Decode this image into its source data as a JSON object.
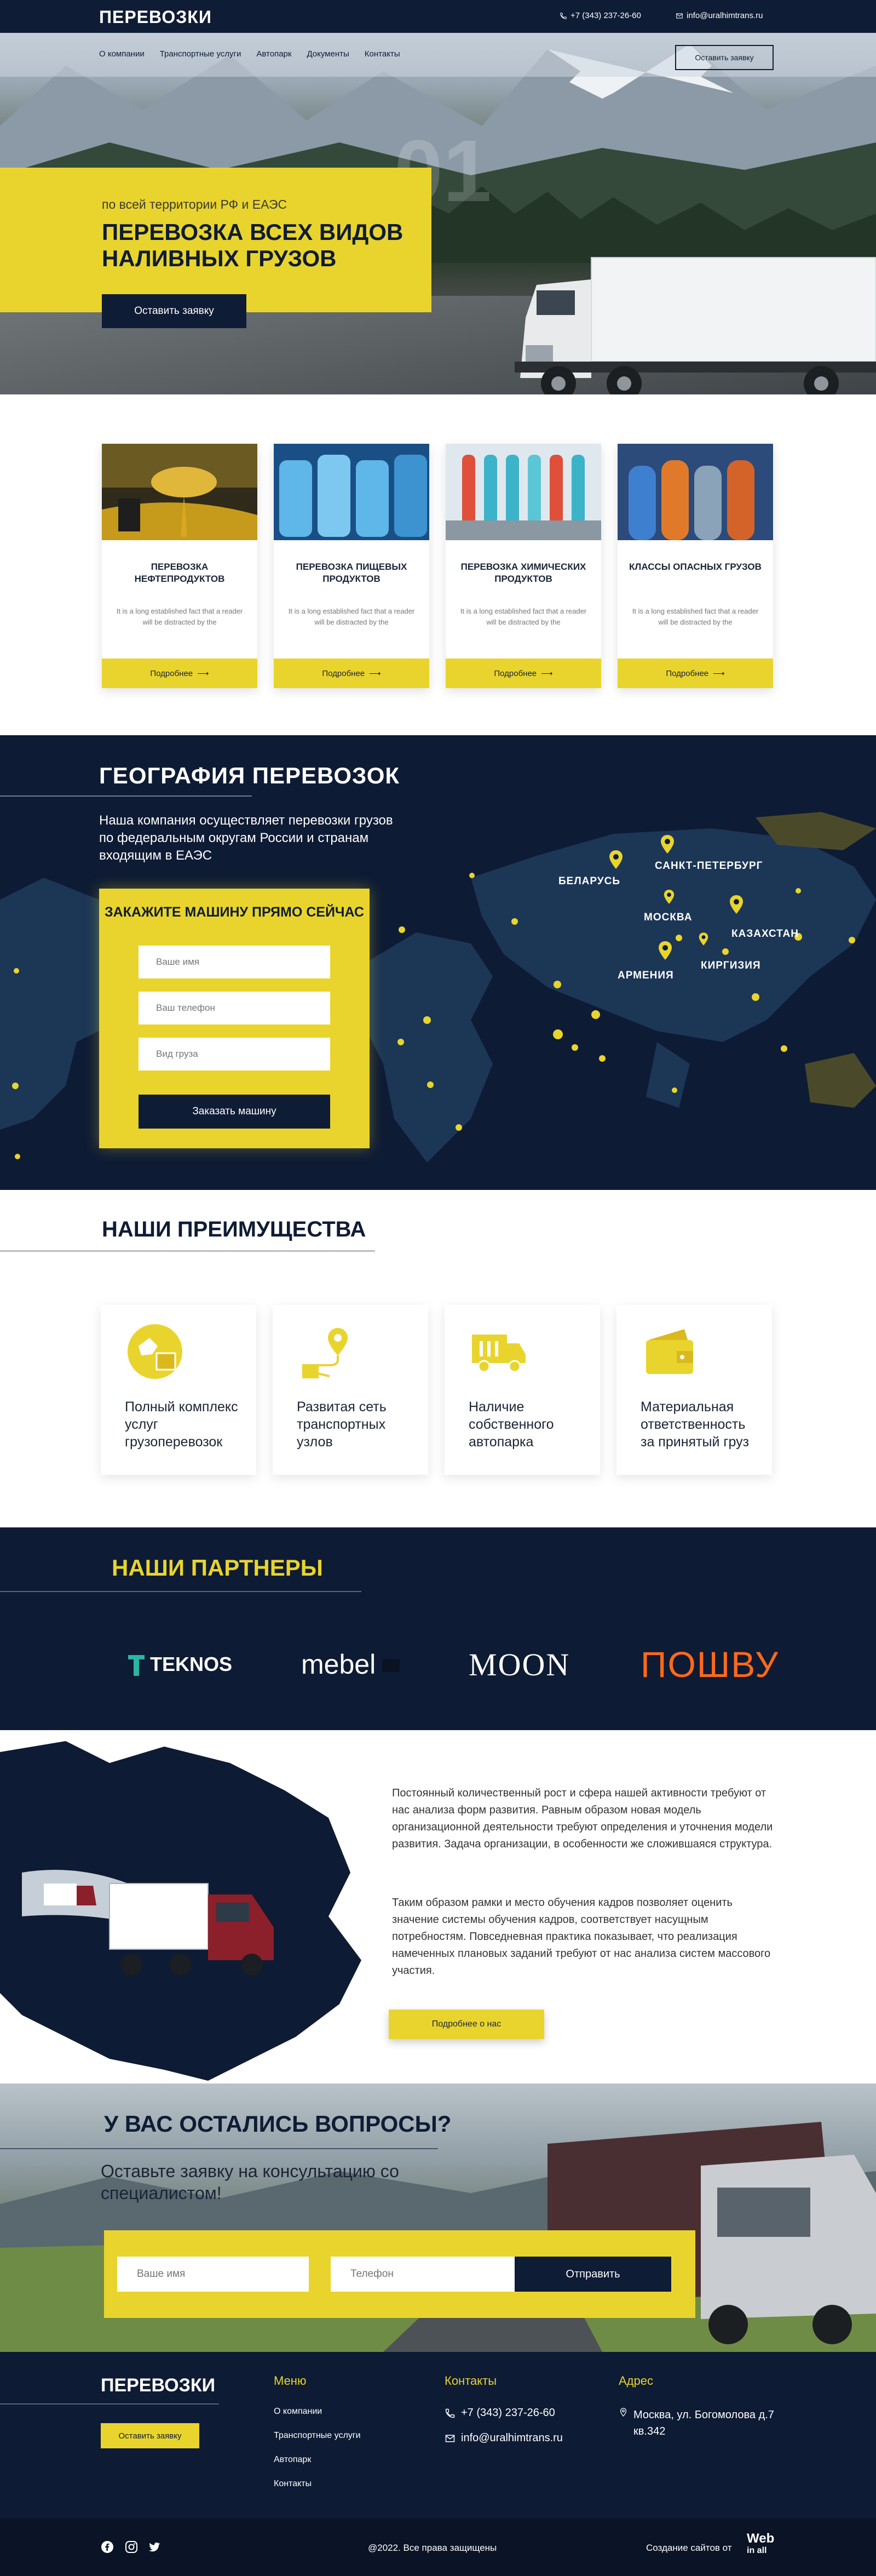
{
  "header": {
    "logo": "ПЕРЕВОЗКИ",
    "phone": "+7 (343) 237-26-60",
    "email": "info@uralhimtrans.ru"
  },
  "nav": {
    "items": [
      "О компании",
      "Транспортные услуги",
      "Автопарк",
      "Документы",
      "Контакты"
    ],
    "cta": "Оставить заявку"
  },
  "hero": {
    "slide_number": "01",
    "subtitle": "по всей территории РФ и ЕАЭС",
    "title": "ПЕРЕВОЗКА ВСЕХ ВИДОВ НАЛИВНЫХ ГРУЗОВ",
    "button": "Оставить заявку",
    "slides_count": 3,
    "active_slide": 2
  },
  "services": [
    {
      "title": "ПЕРЕВОЗКА НЕФТЕПРОДУКТОВ",
      "text": "It is a long established fact that a reader will be distracted by the",
      "button": "Подробнее"
    },
    {
      "title": "ПЕРЕВОЗКА ПИЩЕВЫХ ПРОДУКТОВ",
      "text": "It is a long established fact that a reader will be distracted by the",
      "button": "Подробнее"
    },
    {
      "title": "ПЕРЕВОЗКА ХИМИЧЕСКИХ ПРОДУКТОВ",
      "text": "It is a long established fact that a reader will be distracted by the",
      "button": "Подробнее"
    },
    {
      "title": "КЛАССЫ ОПАСНЫХ ГРУЗОВ",
      "text": "It is a long established fact that a reader will be distracted by the",
      "button": "Подробнее"
    }
  ],
  "geography": {
    "title": "ГЕОГРАФИЯ ПЕРЕВОЗОК",
    "text": "Наша компания осуществляет перевозки грузов по федеральным округам России и странам входящим в ЕАЭС",
    "form": {
      "title": "ЗАКАЖИТЕ МАШИНУ ПРЯМО СЕЙЧАС",
      "name_placeholder": "Ваше имя",
      "phone_placeholder": "Ваш телефон",
      "cargo_placeholder": "Вид груза",
      "button": "Заказать машину"
    },
    "cities": [
      "БЕЛАРУСЬ",
      "САНКТ-ПЕТЕРБУРГ",
      "МОСКВА",
      "КАЗАХСТАН",
      "КИРГИЗИЯ",
      "АРМЕНИЯ"
    ]
  },
  "advantages": {
    "title": "НАШИ ПРЕИМУЩЕСТВА",
    "items": [
      {
        "icon": "globe-box-icon",
        "text": "Полный комплекс услуг грузоперевозок"
      },
      {
        "icon": "route-icon",
        "text": "Развитая сеть транспортных узлов"
      },
      {
        "icon": "truck-icon",
        "text": "Наличие собственного автопарка"
      },
      {
        "icon": "wallet-icon",
        "text": "Материальная ответственность за принятый груз"
      }
    ]
  },
  "partners": {
    "title": "НАШИ ПАРТНЕРЫ",
    "items": [
      "TEKNOS",
      "mebel",
      "MOON",
      "ПОШВУ"
    ]
  },
  "about": {
    "p1": "Постоянный количественный рост и сфера нашей активности требуют от нас анализа форм развития. Равным образом новая модель организационной деятельности требуют определения и уточнения модели развития. Задача организации, в особенности же сложившаяся структура.",
    "p2": "Таким образом рамки и место обучения кадров позволяет оценить значение системы обучения кадров, соответствует насущным потребностям. Повседневная практика показывает, что реализация намеченных плановых заданий требуют от нас анализа систем массового участия.",
    "button": "Подробнее о нас"
  },
  "questions": {
    "title": "У ВАС ОСТАЛИСЬ ВОПРОСЫ?",
    "subtitle": "Оставьте заявку на консультацию со специалистом!",
    "name_placeholder": "Ваше имя",
    "phone_placeholder": "Телефон",
    "button": "Отправить"
  },
  "footer": {
    "logo": "ПЕРЕВОЗКИ",
    "button": "Оставить заявку",
    "menu_title": "Меню",
    "menu": [
      "О компании",
      "Транспортные услуги",
      "Автопарк",
      "Контакты"
    ],
    "contacts_title": "Контакты",
    "phone": "+7 (343) 237-26-60",
    "email": "info@uralhimtrans.ru",
    "address_title": "Адрес",
    "address": "Москва, ул. Богомолова д.7 кв.342",
    "copyright": "@2022. Все права защищены",
    "created_by": "Создание сайтов от",
    "agency_line1": "Web",
    "agency_line2": "in all"
  },
  "colors": {
    "navy": "#0f1c35",
    "yellow": "#e9d42d"
  }
}
